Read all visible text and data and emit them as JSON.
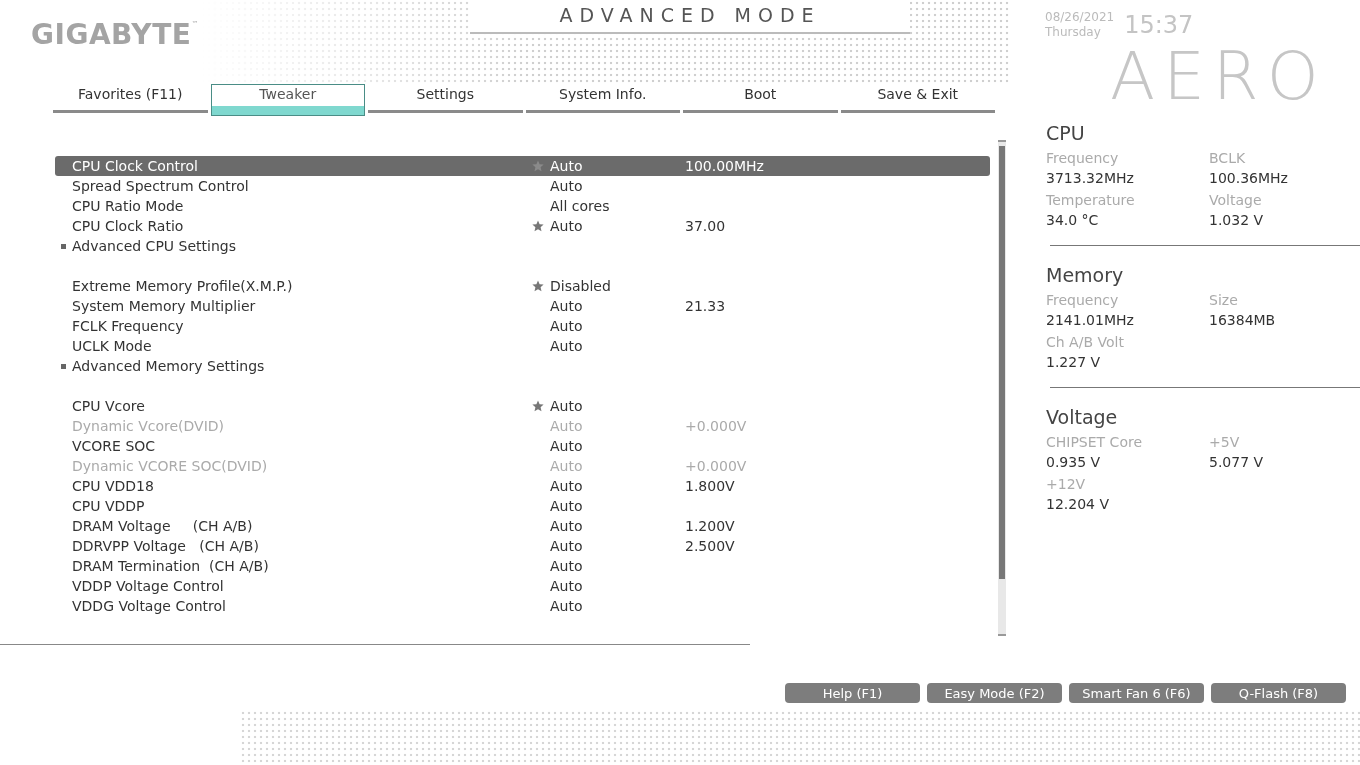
{
  "brand": "GIGABYTE",
  "brand_mark": "™",
  "mode_title": "ADVANCED MODE",
  "clock": {
    "date": "08/26/2021",
    "weekday": "Thursday",
    "time": "15:37"
  },
  "series_logo": "AERO",
  "tabs": [
    {
      "label": "Favorites (F11)",
      "selected": false
    },
    {
      "label": "Tweaker",
      "selected": true
    },
    {
      "label": "Settings",
      "selected": false
    },
    {
      "label": "System Info.",
      "selected": false
    },
    {
      "label": "Boot",
      "selected": false
    },
    {
      "label": "Save & Exit",
      "selected": false
    }
  ],
  "settings": {
    "groups": [
      {
        "items": [
          {
            "kind": "setting",
            "label": "CPU Clock Control",
            "value": "Auto",
            "detail": "100.00MHz",
            "favorite": true,
            "disabled": false,
            "selected": true
          },
          {
            "kind": "setting",
            "label": "Spread Spectrum Control",
            "value": "Auto",
            "favorite": false,
            "disabled": false,
            "selected": false
          },
          {
            "kind": "setting",
            "label": "CPU Ratio Mode",
            "value": "All cores",
            "favorite": false,
            "disabled": false,
            "selected": false
          },
          {
            "kind": "setting",
            "label": "CPU Clock Ratio",
            "value": "Auto",
            "detail": "37.00",
            "favorite": true,
            "disabled": false,
            "selected": false
          },
          {
            "kind": "submenu",
            "label": "Advanced CPU Settings",
            "favorite": false,
            "disabled": false,
            "selected": false
          }
        ]
      },
      {
        "items": [
          {
            "kind": "setting",
            "label": "Extreme Memory Profile(X.M.P.)",
            "value": "Disabled",
            "favorite": true,
            "disabled": false,
            "selected": false
          },
          {
            "kind": "setting",
            "label": "System Memory Multiplier",
            "value": "Auto",
            "detail": "21.33",
            "favorite": false,
            "disabled": false,
            "selected": false
          },
          {
            "kind": "setting",
            "label": "FCLK Frequency",
            "value": "Auto",
            "favorite": false,
            "disabled": false,
            "selected": false
          },
          {
            "kind": "setting",
            "label": "UCLK Mode",
            "value": "Auto",
            "favorite": false,
            "disabled": false,
            "selected": false
          },
          {
            "kind": "submenu",
            "label": "Advanced Memory Settings",
            "favorite": false,
            "disabled": false,
            "selected": false
          }
        ]
      },
      {
        "items": [
          {
            "kind": "setting",
            "label": "CPU Vcore",
            "value": "Auto",
            "favorite": true,
            "disabled": false,
            "selected": false
          },
          {
            "kind": "setting",
            "label": "Dynamic Vcore(DVID)",
            "value": "Auto",
            "detail": "+0.000V",
            "favorite": false,
            "disabled": true,
            "selected": false
          },
          {
            "kind": "setting",
            "label": "VCORE SOC",
            "value": "Auto",
            "favorite": false,
            "disabled": false,
            "selected": false
          },
          {
            "kind": "setting",
            "label": "Dynamic VCORE SOC(DVID)",
            "value": "Auto",
            "detail": "+0.000V",
            "favorite": false,
            "disabled": true,
            "selected": false
          },
          {
            "kind": "setting",
            "label": "CPU VDD18",
            "value": "Auto",
            "detail": "1.800V",
            "favorite": false,
            "disabled": false,
            "selected": false
          },
          {
            "kind": "setting",
            "label": "CPU VDDP",
            "value": "Auto",
            "favorite": false,
            "disabled": false,
            "selected": false
          },
          {
            "kind": "setting",
            "label": "DRAM Voltage     (CH A/B)",
            "value": "Auto",
            "detail": "1.200V",
            "favorite": false,
            "disabled": false,
            "selected": false
          },
          {
            "kind": "setting",
            "label": "DDRVPP Voltage   (CH A/B)",
            "value": "Auto",
            "detail": "2.500V",
            "favorite": false,
            "disabled": false,
            "selected": false
          },
          {
            "kind": "setting",
            "label": "DRAM Termination  (CH A/B)",
            "value": "Auto",
            "favorite": false,
            "disabled": false,
            "selected": false
          },
          {
            "kind": "setting",
            "label": "VDDP Voltage Control",
            "value": "Auto",
            "favorite": false,
            "disabled": false,
            "selected": false
          },
          {
            "kind": "setting",
            "label": "VDDG Voltage Control",
            "value": "Auto",
            "favorite": false,
            "disabled": false,
            "selected": false
          }
        ]
      }
    ]
  },
  "monitor": [
    {
      "title": "CPU",
      "fields": [
        {
          "label": "Frequency",
          "value": "3713.32MHz"
        },
        {
          "label": "BCLK",
          "value": "100.36MHz"
        },
        {
          "label": "Temperature",
          "value": "34.0 °C"
        },
        {
          "label": "Voltage",
          "value": "1.032 V"
        }
      ]
    },
    {
      "title": "Memory",
      "fields": [
        {
          "label": "Frequency",
          "value": "2141.01MHz"
        },
        {
          "label": "Size",
          "value": "16384MB"
        },
        {
          "label": "Ch A/B Volt",
          "value": "1.227 V"
        }
      ]
    },
    {
      "title": "Voltage",
      "fields": [
        {
          "label": "CHIPSET Core",
          "value": "0.935 V"
        },
        {
          "label": "+5V",
          "value": "5.077 V"
        },
        {
          "label": "+12V",
          "value": "12.204 V"
        }
      ]
    }
  ],
  "buttons": [
    "Help (F1)",
    "Easy Mode (F2)",
    "Smart Fan 6 (F6)",
    "Q-Flash (F8)"
  ]
}
